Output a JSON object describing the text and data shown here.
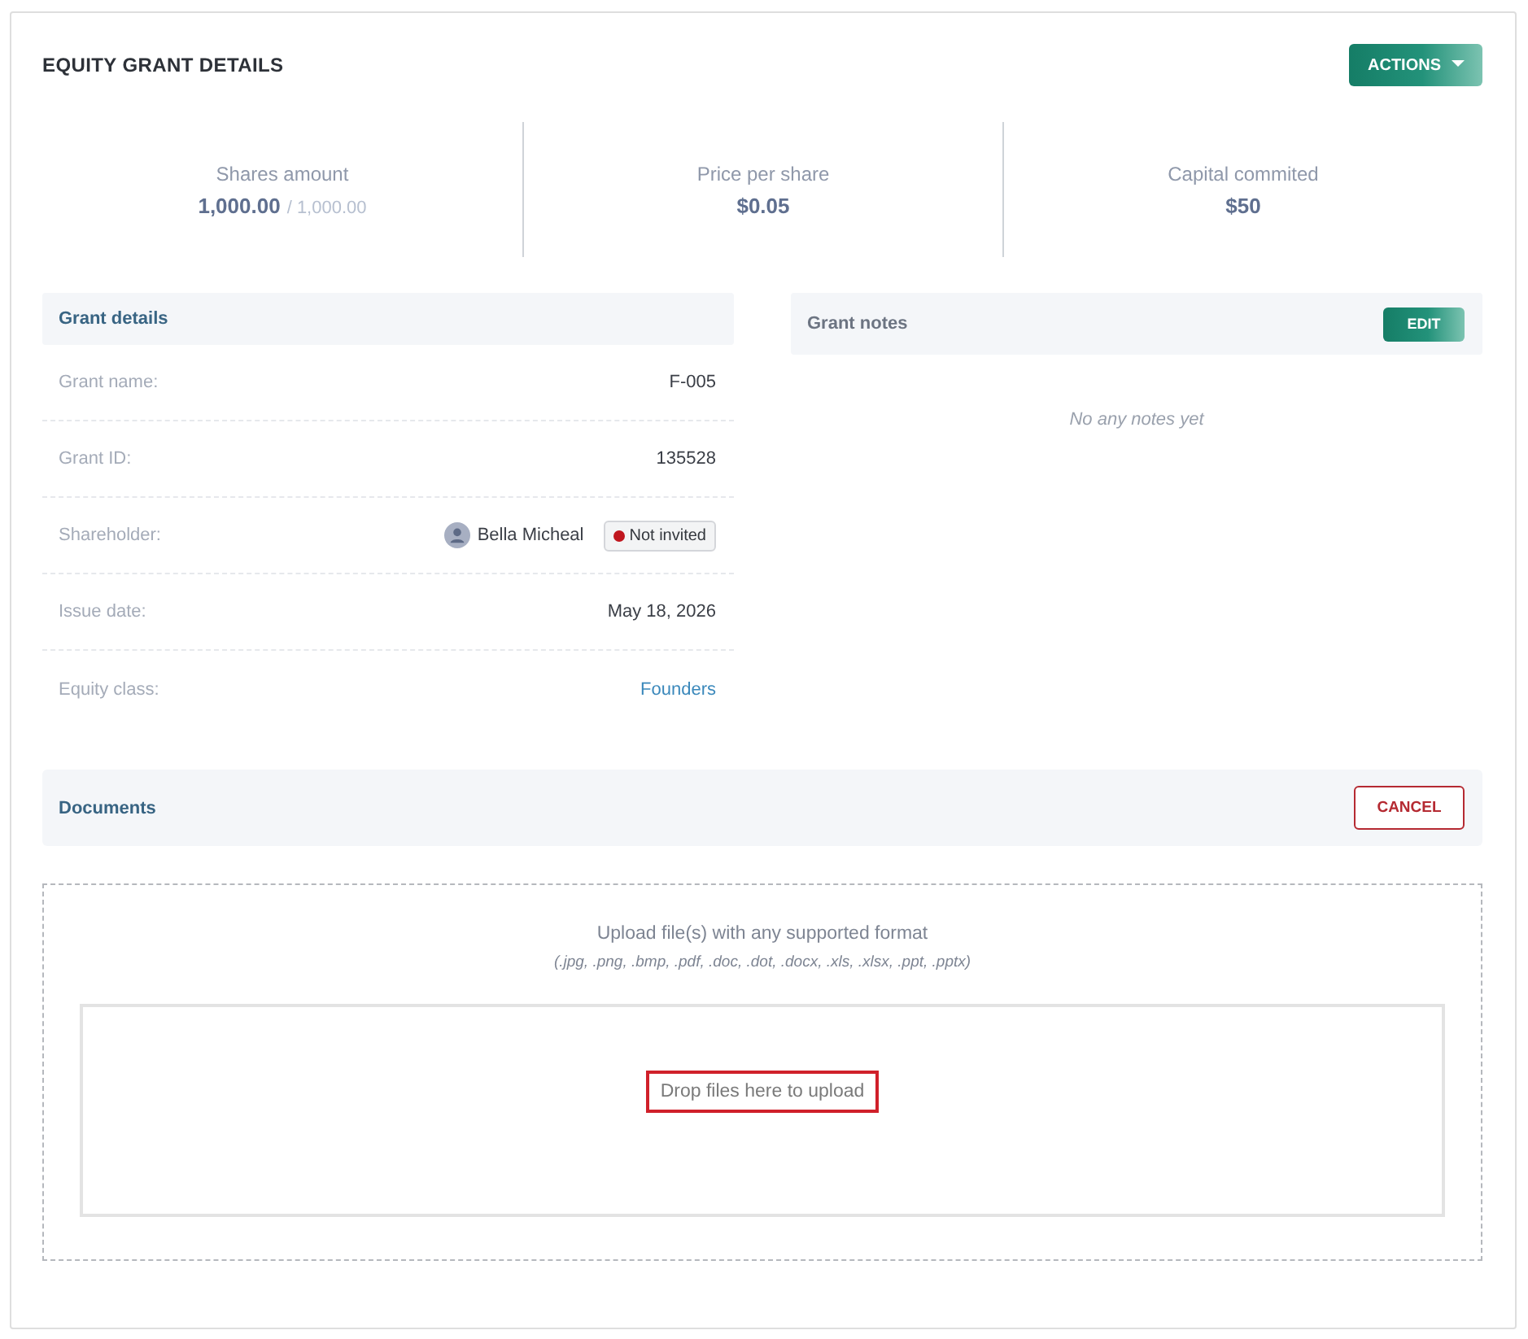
{
  "title": "EQUITY GRANT DETAILS",
  "actions_button": {
    "label": "ACTIONS"
  },
  "stats": [
    {
      "label": "Shares amount",
      "value": "1,000.00",
      "total": "/ 1,000.00"
    },
    {
      "label": "Price per share",
      "value": "$0.05"
    },
    {
      "label": "Capital commited",
      "value": "$50"
    }
  ],
  "grant_details": {
    "title": "Grant details",
    "rows": [
      {
        "label": "Grant name:",
        "kind": "text",
        "value": "F-005"
      },
      {
        "label": "Grant ID:",
        "kind": "text",
        "value": "135528"
      },
      {
        "label": "Shareholder:",
        "kind": "person",
        "value": "Bella Micheal",
        "badge": {
          "label": "Not invited",
          "color": "#c0161e"
        }
      },
      {
        "label": "Issue date:",
        "kind": "text",
        "value": "May 18, 2026"
      },
      {
        "label": "Equity class:",
        "kind": "link",
        "value": "Founders"
      }
    ]
  },
  "grant_notes": {
    "title": "Grant notes",
    "button": "EDIT",
    "empty_text": "No any notes yet"
  },
  "documents": {
    "title": "Documents",
    "button": "CANCEL"
  },
  "upload": {
    "title": "Upload file(s) with any supported format",
    "formats": "(.jpg, .png, .bmp, .pdf, .doc, .dot, .docx, .xls, .xlsx, .ppt, .pptx)",
    "drop_text": "Drop files here to upload",
    "highlighted": true
  }
}
